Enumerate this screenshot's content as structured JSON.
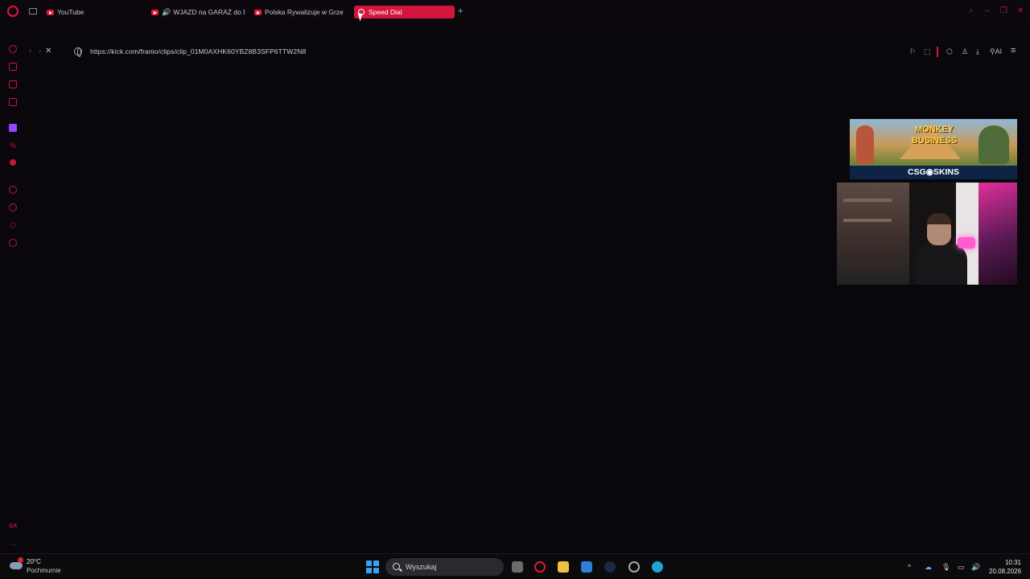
{
  "browser": {
    "tabs": [
      {
        "label": "YouTube",
        "icon": "youtube-icon"
      },
      {
        "label": "WJAZD na GARAŻ do D",
        "icon": "youtube-icon",
        "audio": true
      },
      {
        "label": "Polska Rywalizuje w Grze",
        "icon": "youtube-icon"
      },
      {
        "label": "Speed Dial",
        "icon": "opera-icon",
        "active": true
      }
    ],
    "new_tab_label": "+",
    "url": "https://kick.com/franio/clips/clip_01M0AXHK60YBZ8B3SFP6TTW2N8",
    "toolbar_ai_label": "AI",
    "accent_color": "#d4163d"
  },
  "sidebar": {
    "bottom_label": "GX",
    "more_label": "..."
  },
  "ad": {
    "title": "MONKEY BUSINESS",
    "brand": "CSG◉SKINS"
  },
  "taskbar": {
    "weather_temp": "20°C",
    "weather_condition": "Pochmurnie",
    "search_placeholder": "Wyszukaj",
    "time": "10:31",
    "date": "20.08.2026"
  }
}
